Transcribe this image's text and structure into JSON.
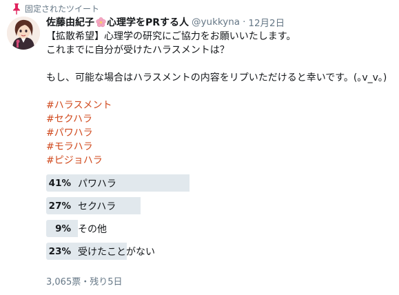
{
  "pinned_label": "固定されたツイート",
  "author": {
    "name": "佐藤由紀子",
    "name_suffix": "心理学をPRする人",
    "handle": "@yukkyna",
    "separator": "·",
    "date": "12月2日"
  },
  "body_lines": [
    "【拡散希望】心理学の研究にご協力をお願いいたします。",
    "これまでに自分が受けたハラスメントは？",
    "もし、可能な場合はハラスメントの内容をリプいただけると幸いです。(｡v_v｡)"
  ],
  "hashtags": [
    "#ハラスメント",
    "#セクハラ",
    "#パワハラ",
    "#モラハラ",
    "#ピジョハラ"
  ],
  "poll": {
    "choices": [
      {
        "percent_label": "41%",
        "label": "パワハラ",
        "percent": 41
      },
      {
        "percent_label": "27%",
        "label": "セクハラ",
        "percent": 27
      },
      {
        "percent_label": "9%",
        "label": "その他",
        "percent": 9
      },
      {
        "percent_label": "23%",
        "label": "受けたことがない",
        "percent": 23
      }
    ],
    "meta": "3,065票・残り5日"
  },
  "colors": {
    "hashtag": "#d0491d",
    "poll_bar": "#e1e8ed",
    "muted": "#657786",
    "pin": "#e0245e"
  },
  "icons": {
    "pin": "pin-icon",
    "blossom": "cherry-blossom-icon",
    "avatar": "avatar-illustration"
  }
}
